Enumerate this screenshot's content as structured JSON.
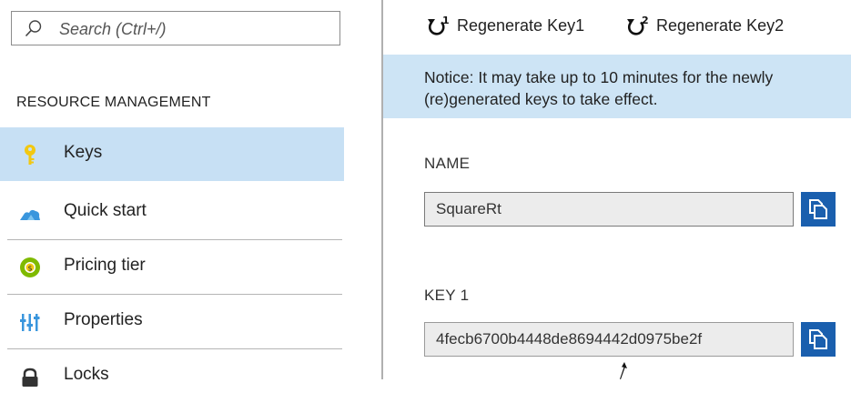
{
  "search": {
    "placeholder": "Search (Ctrl+/)"
  },
  "sidebar": {
    "section_heading": "RESOURCE MANAGEMENT",
    "items": [
      {
        "label": "Keys",
        "icon": "key-icon",
        "selected": true
      },
      {
        "label": "Quick start",
        "icon": "cloud-icon",
        "selected": false
      },
      {
        "label": "Pricing tier",
        "icon": "pricing-tier-icon",
        "selected": false
      },
      {
        "label": "Properties",
        "icon": "properties-icon",
        "selected": false
      },
      {
        "label": "Locks",
        "icon": "lock-icon",
        "selected": false
      }
    ]
  },
  "toolbar": {
    "regenerate_key1": {
      "label": "Regenerate Key1",
      "icon": "regenerate-1-icon"
    },
    "regenerate_key2": {
      "label": "Regenerate Key2",
      "icon": "regenerate-2-icon"
    }
  },
  "notice": {
    "text": "Notice: It may take up to 10 minutes for the newly (re)generated keys to take effect."
  },
  "fields": {
    "name": {
      "label": "NAME",
      "value": "SquareRt"
    },
    "key1": {
      "label": "KEY 1",
      "value": "4fecb6700b4448de8694442d0975be2f"
    }
  },
  "colors": {
    "selected_item_bg": "#c7e0f4",
    "notice_bg": "#cde4f5",
    "copy_button_bg": "#1a5fae",
    "key_icon": "#f2c811",
    "cloud_icon": "#3a96dd",
    "pricing_icon": "#7fba00"
  }
}
